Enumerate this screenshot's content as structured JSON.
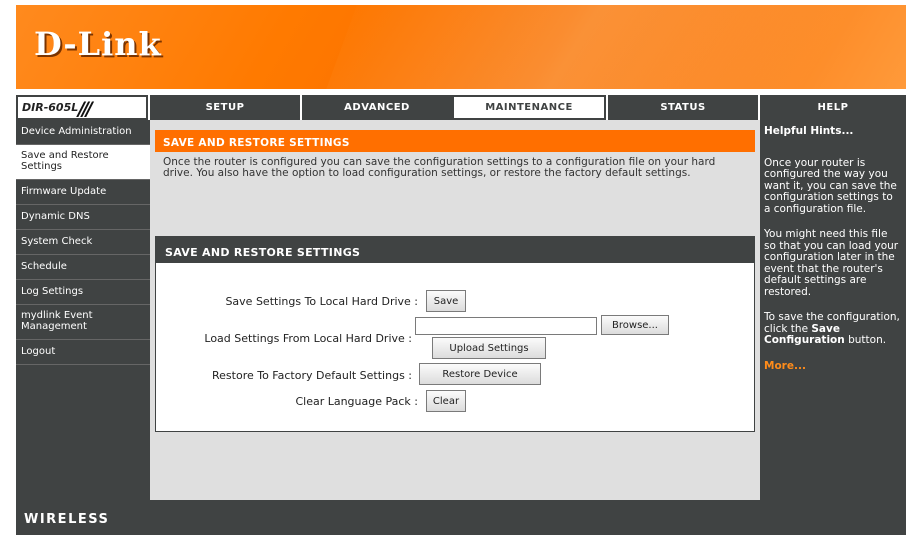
{
  "brand": {
    "logo_text": "D-Link"
  },
  "nav": {
    "model": "DIR-605L",
    "tabs": [
      {
        "label": "SETUP",
        "active": false
      },
      {
        "label": "ADVANCED",
        "active": false
      },
      {
        "label": "MAINTENANCE",
        "active": true
      },
      {
        "label": "STATUS",
        "active": false
      },
      {
        "label": "HELP",
        "active": false
      }
    ]
  },
  "sidebar": {
    "items": [
      {
        "label": "Device Administration",
        "active": false
      },
      {
        "label": "Save and Restore Settings",
        "active": true
      },
      {
        "label": "Firmware Update",
        "active": false
      },
      {
        "label": "Dynamic DNS",
        "active": false
      },
      {
        "label": "System Check",
        "active": false
      },
      {
        "label": "Schedule",
        "active": false
      },
      {
        "label": "Log Settings",
        "active": false
      },
      {
        "label": "mydlink Event Management",
        "active": false
      },
      {
        "label": "Logout",
        "active": false
      }
    ]
  },
  "intro": {
    "title": "SAVE AND RESTORE SETTINGS",
    "text": "Once the router is configured you can save the configuration settings to a configuration file on your hard drive. You also have the option to load configuration settings, or restore the factory default settings."
  },
  "settings": {
    "title": "SAVE AND RESTORE SETTINGS",
    "save_label": "Save Settings To Local Hard Drive :",
    "save_button": "Save",
    "load_label": "Load Settings From Local Hard Drive :",
    "file_value": "",
    "browse_button": "Browse...",
    "upload_button": "Upload Settings",
    "restore_label": "Restore To Factory Default Settings :",
    "restore_button": "Restore Device",
    "clear_label": "Clear Language Pack :",
    "clear_button": "Clear"
  },
  "help": {
    "title": "Helpful Hints...",
    "p1": "Once your router is configured the way you want it, you can save the configuration settings to a configuration file.",
    "p2": "You might need this file so that you can load your configuration later in the event that the router's default settings are restored.",
    "p3_before": "To save the configuration, click the",
    "p3_bold": "Save Configuration",
    "p3_after": "button.",
    "more": "More..."
  },
  "footer": {
    "text": "WIRELESS"
  },
  "colors": {
    "orange": "#ff6f00",
    "dark": "#404343",
    "panel_bg": "#dfdfdf",
    "more_link": "#ff8c1a"
  }
}
